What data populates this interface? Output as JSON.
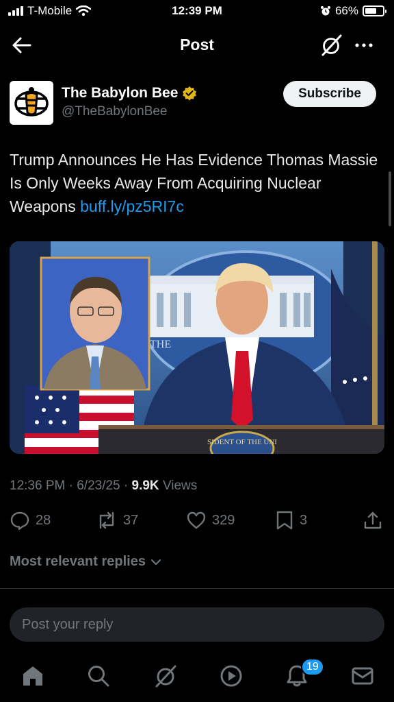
{
  "status_bar": {
    "carrier": "T-Mobile",
    "time": "12:39 PM",
    "battery": "66%"
  },
  "header": {
    "title": "Post"
  },
  "author": {
    "name": "The Babylon Bee",
    "handle": "@TheBabylonBee",
    "subscribe_label": "Subscribe"
  },
  "tweet": {
    "text": "Trump Announces He Has Evidence Thomas Massie Is Only Weeks Away From Acquiring Nuclear Weapons ",
    "link": "buff.ly/pz5RI7c"
  },
  "media": {
    "podium_text": "SIDENT OF THE UNI",
    "backdrop_text": "THE"
  },
  "meta": {
    "time": "12:36 PM",
    "date": "6/23/25",
    "views_count": "9.9K",
    "views_label": "Views"
  },
  "actions": {
    "replies": "28",
    "reposts": "37",
    "likes": "329",
    "bookmarks": "3"
  },
  "replies_sort": {
    "label": "Most relevant replies"
  },
  "reply_input": {
    "placeholder": "Post your reply"
  },
  "tabbar": {
    "notifications_badge": "19"
  },
  "colors": {
    "accent": "#1d9bf0",
    "background": "#000000",
    "muted": "#71767b",
    "verified": "#e2b719"
  }
}
